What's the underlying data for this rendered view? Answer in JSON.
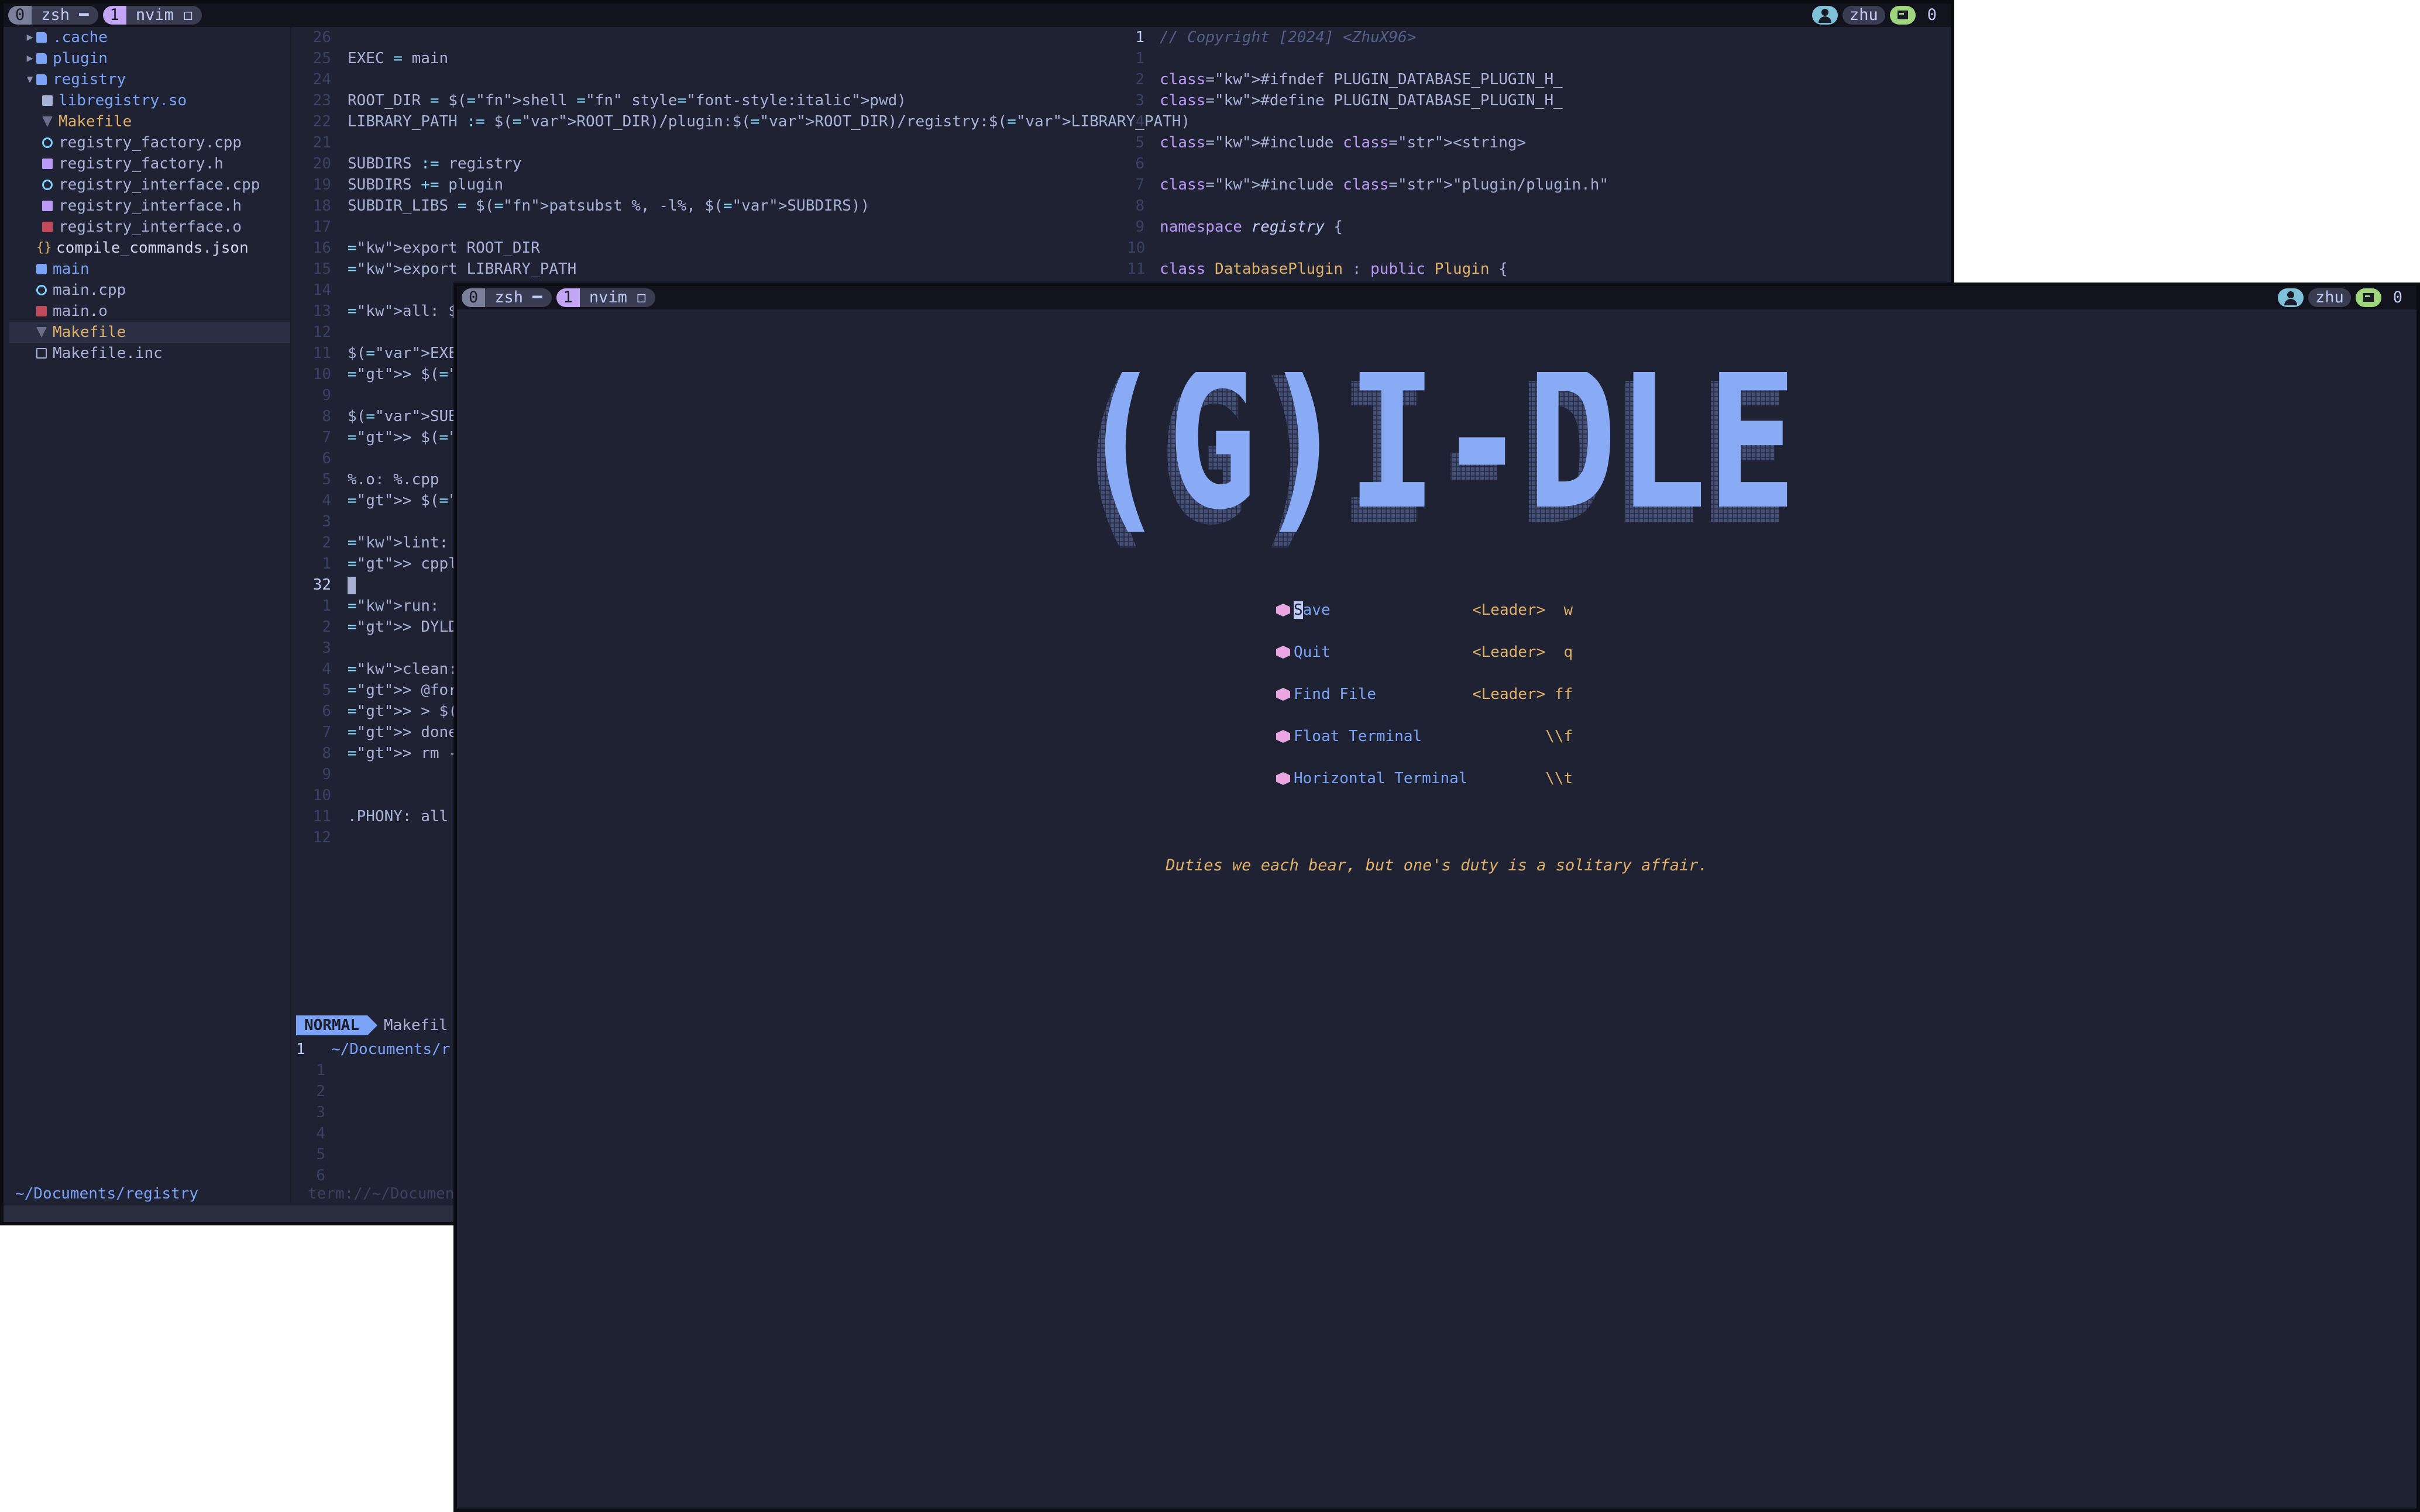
{
  "back_window": {
    "tmux": {
      "tabs": [
        {
          "index": "0",
          "name": "zsh ━"
        },
        {
          "index": "1",
          "name": "nvim ◻"
        }
      ],
      "user": "zhu",
      "sessions": "0"
    },
    "tree": [
      {
        "label": ".cache",
        "kind": "dir-closed",
        "depth": 0
      },
      {
        "label": "plugin",
        "kind": "dir-closed",
        "depth": 0
      },
      {
        "label": "registry",
        "kind": "dir-open",
        "depth": 0
      },
      {
        "label": "libregistry.so",
        "kind": "so",
        "depth": 1
      },
      {
        "label": "Makefile",
        "kind": "makefile",
        "depth": 1
      },
      {
        "label": "registry_factory.cpp",
        "kind": "cpp",
        "depth": 1
      },
      {
        "label": "registry_factory.h",
        "kind": "h",
        "depth": 1
      },
      {
        "label": "registry_interface.cpp",
        "kind": "cpp",
        "depth": 1
      },
      {
        "label": "registry_interface.h",
        "kind": "h",
        "depth": 1
      },
      {
        "label": "registry_interface.o",
        "kind": "o",
        "depth": 1
      },
      {
        "label": "compile_commands.json",
        "kind": "json",
        "depth": 0
      },
      {
        "label": "main",
        "kind": "exe",
        "depth": 0
      },
      {
        "label": "main.cpp",
        "kind": "cpp",
        "depth": 0
      },
      {
        "label": "main.o",
        "kind": "o",
        "depth": 0
      },
      {
        "label": "Makefile",
        "kind": "makefile",
        "depth": 0,
        "selected": true
      },
      {
        "label": "Makefile.inc",
        "kind": "inc",
        "depth": 0
      }
    ],
    "cwd": "~/Documents/registry",
    "left_code": [
      {
        "n": "26",
        "t": ""
      },
      {
        "n": "25",
        "t": "EXEC = main"
      },
      {
        "n": "24",
        "t": ""
      },
      {
        "n": "23",
        "t": "ROOT_DIR = $(shell pwd)"
      },
      {
        "n": "22",
        "t": "LIBRARY_PATH := $(ROOT_DIR)/plugin:$(ROOT_DIR)/registry:$(LIBRARY_PATH)"
      },
      {
        "n": "21",
        "t": ""
      },
      {
        "n": "20",
        "t": "SUBDIRS := registry"
      },
      {
        "n": "19",
        "t": "SUBDIRS += plugin"
      },
      {
        "n": "18",
        "t": "SUBDIR_LIBS = $(patsubst %, -l%, $(SUBDIRS))"
      },
      {
        "n": "17",
        "t": ""
      },
      {
        "n": "16",
        "t": "export ROOT_DIR"
      },
      {
        "n": "15",
        "t": "export LIBRARY_PATH"
      },
      {
        "n": "14",
        "t": ""
      },
      {
        "n": "13",
        "t": "all: $(SUBDIR"
      },
      {
        "n": "12",
        "t": ""
      },
      {
        "n": "11",
        "t": "$(EXEC): $(OB"
      },
      {
        "n": "10",
        "t": "> $(CXX) $(CX"
      },
      {
        "n": "9",
        "t": ""
      },
      {
        "n": "8",
        "t": "$(SUBDIRS):"
      },
      {
        "n": "7",
        "t": "> $(MAKE) -C"
      },
      {
        "n": "6",
        "t": ""
      },
      {
        "n": "5",
        "t": "%.o: %.cpp"
      },
      {
        "n": "4",
        "t": "> $(CXX) $(CX"
      },
      {
        "n": "3",
        "t": ""
      },
      {
        "n": "2",
        "t": "lint:"
      },
      {
        "n": "1",
        "t": "> cpplint --r"
      },
      {
        "n": "32",
        "t": ""
      },
      {
        "n": "1",
        "t": "run:"
      },
      {
        "n": "2",
        "t": "> DYLD_LIBRAR"
      },
      {
        "n": "3",
        "t": ""
      },
      {
        "n": "4",
        "t": "clean:"
      },
      {
        "n": "5",
        "t": "> @for dir in"
      },
      {
        "n": "6",
        "t": "> > $(MAKE) -"
      },
      {
        "n": "7",
        "t": "> done"
      },
      {
        "n": "8",
        "t": "> rm -f $(OBJ"
      },
      {
        "n": "9",
        "t": ""
      },
      {
        "n": "10",
        "t": ""
      },
      {
        "n": "11",
        "t": ".PHONY: all $"
      },
      {
        "n": "12",
        "t": ""
      }
    ],
    "right_code": [
      {
        "n": "1",
        "t": "// Copyright [2024] <ZhuX96>"
      },
      {
        "n": "1",
        "t": ""
      },
      {
        "n": "2",
        "t": "#ifndef PLUGIN_DATABASE_PLUGIN_H_"
      },
      {
        "n": "3",
        "t": "#define PLUGIN_DATABASE_PLUGIN_H_"
      },
      {
        "n": "4",
        "t": ""
      },
      {
        "n": "5",
        "t": "#include <string>"
      },
      {
        "n": "6",
        "t": ""
      },
      {
        "n": "7",
        "t": "#include \"plugin/plugin.h\""
      },
      {
        "n": "8",
        "t": ""
      },
      {
        "n": "9",
        "t": "namespace registry {"
      },
      {
        "n": "10",
        "t": ""
      },
      {
        "n": "11",
        "t": "class DatabasePlugin : public Plugin {"
      }
    ],
    "status": {
      "mode": "NORMAL",
      "file": "Makefil"
    },
    "terminal": {
      "first_line_num": "1",
      "path": "~/Documents/r",
      "lines": [
        "1",
        "2",
        "3",
        "4",
        "5",
        "6"
      ],
      "bottom": "term://~/Documen"
    }
  },
  "front_window": {
    "tmux": {
      "tabs": [
        {
          "index": "0",
          "name": "zsh ━"
        },
        {
          "index": "1",
          "name": "nvim ◻"
        }
      ],
      "user": "zhu",
      "sessions": "0"
    },
    "logo_text": "(G)I-DLE",
    "menu": [
      {
        "label": "Save",
        "key": "<Leader>  w"
      },
      {
        "label": "Quit",
        "key": "<Leader>  q"
      },
      {
        "label": "Find File",
        "key": "<Leader> ff"
      },
      {
        "label": "Float Terminal",
        "key": "        \\\\f"
      },
      {
        "label": "Horizontal Terminal",
        "key": "        \\\\t"
      }
    ],
    "quote": "Duties we each bear, but one's duty is a solitary affair."
  },
  "colors": {
    "bg": "#1f2233",
    "accent": "#7aa2f7",
    "keyword": "#bb9af7",
    "string": "#9ece6a",
    "orange": "#e0af68",
    "comment": "#565f89",
    "tab_active": "#c3a5f5"
  }
}
